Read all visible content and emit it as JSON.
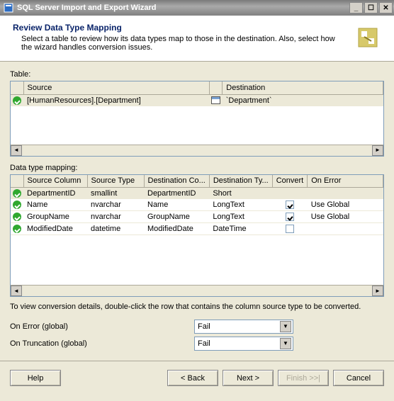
{
  "window": {
    "title": "SQL Server Import and Export Wizard"
  },
  "header": {
    "heading": "Review Data Type Mapping",
    "subtext": "Select a table to review how its data types map to those in the destination. Also, select how the wizard handles conversion issues."
  },
  "table_section": {
    "label": "Table:",
    "columns": {
      "source": "Source",
      "destination": "Destination"
    },
    "row": {
      "source": "[HumanResources].[Department]",
      "destination": "`Department`"
    }
  },
  "mapping_section": {
    "label": "Data type mapping:",
    "columns": {
      "c1": "Source Column",
      "c2": "Source Type",
      "c3": "Destination Co...",
      "c4": "Destination Ty...",
      "c5": "Convert",
      "c6": "On Error"
    },
    "rows": [
      {
        "c1": "DepartmentID",
        "c2": "smallint",
        "c3": "DepartmentID",
        "c4": "Short",
        "convert": false,
        "c6": "",
        "sel": true
      },
      {
        "c1": "Name",
        "c2": "nvarchar",
        "c3": "Name",
        "c4": "LongText",
        "convert": true,
        "c6": "Use Global",
        "sel": false
      },
      {
        "c1": "GroupName",
        "c2": "nvarchar",
        "c3": "GroupName",
        "c4": "LongText",
        "convert": true,
        "c6": "Use Global",
        "sel": false
      },
      {
        "c1": "ModifiedDate",
        "c2": "datetime",
        "c3": "ModifiedDate",
        "c4": "DateTime",
        "convert": false,
        "c6": "",
        "sel": false
      }
    ]
  },
  "hint": "To view conversion details, double-click the row that contains the column source type to be converted.",
  "globals": {
    "on_error_label": "On Error (global)",
    "on_error_value": "Fail",
    "on_truncation_label": "On Truncation (global)",
    "on_truncation_value": "Fail"
  },
  "buttons": {
    "help": "Help",
    "back": "< Back",
    "next": "Next >",
    "finish": "Finish >>|",
    "cancel": "Cancel"
  }
}
